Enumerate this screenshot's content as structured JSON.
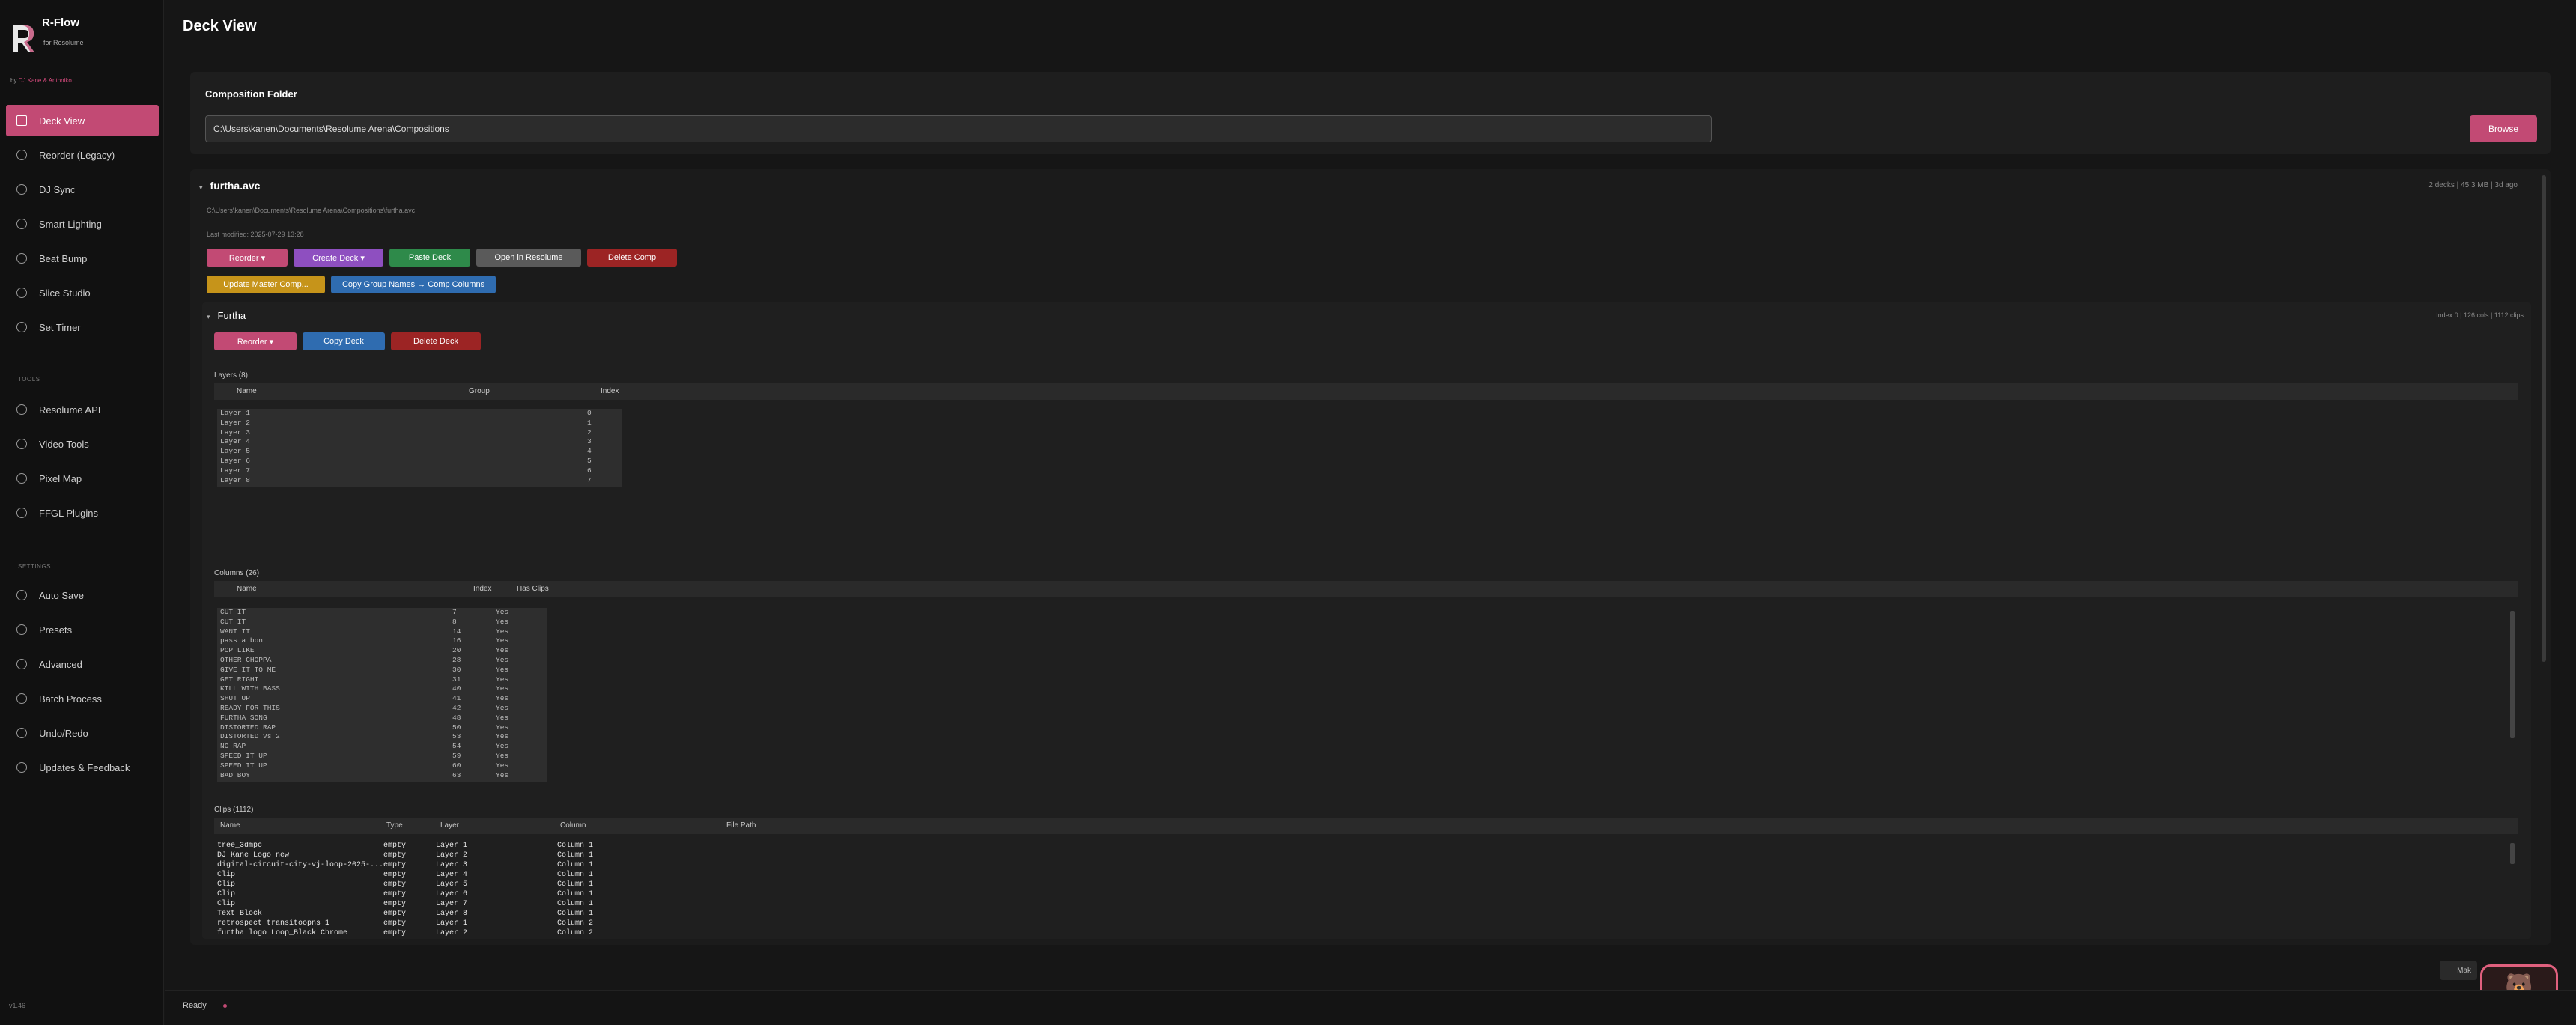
{
  "app": {
    "name": "R-Flow",
    "subtitle": "for Resolume",
    "byline_prefix": "by ",
    "byline_authors": "DJ Kane & Antoniko",
    "version": "v1.46",
    "accent": "#c24a74"
  },
  "nav": {
    "main": [
      "Deck View",
      "Reorder (Legacy)",
      "DJ Sync",
      "Smart Lighting",
      "Beat Bump",
      "Slice Studio",
      "Set Timer"
    ],
    "tools_label": "TOOLS",
    "tools": [
      "Resolume API",
      "Video Tools",
      "Pixel Map",
      "FFGL Plugins"
    ],
    "settings_label": "SETTINGS",
    "settings": [
      "Auto Save",
      "Presets",
      "Advanced",
      "Batch Process",
      "Undo/Redo",
      "Updates & Feedback"
    ]
  },
  "page": {
    "title": "Deck View"
  },
  "folder": {
    "label": "Composition Folder",
    "path": "C:\\Users\\kanen\\Documents\\Resolume Arena\\Compositions",
    "browse_label": "Browse"
  },
  "comp": {
    "name": "furtha.avc",
    "meta": "2 decks  |  45.3 MB  |  3d ago",
    "path": "C:\\Users\\kanen\\Documents\\Resolume Arena\\Compositions\\furtha.avc",
    "modified": "Last modified: 2025-07-29 13:28",
    "buttons": [
      "Reorder ▾",
      "Create Deck ▾",
      "Paste Deck",
      "Open in Resolume",
      "Delete Comp",
      "Update Master Comp...",
      "Copy Group Names → Comp Columns"
    ]
  },
  "deck": {
    "name": "Furtha",
    "meta": "Index 0  |  126 cols  |  1112 clips",
    "buttons": [
      "Reorder ▾",
      "Copy Deck",
      "Delete Deck"
    ],
    "layers": {
      "label": "Layers (8)",
      "headers": [
        "Name",
        "Group",
        "Index"
      ],
      "rows": [
        [
          "Layer 1",
          "0"
        ],
        [
          "Layer 2",
          "1"
        ],
        [
          "Layer 3",
          "2"
        ],
        [
          "Layer 4",
          "3"
        ],
        [
          "Layer 5",
          "4"
        ],
        [
          "Layer 6",
          "5"
        ],
        [
          "Layer 7",
          "6"
        ],
        [
          "Layer 8",
          "7"
        ]
      ]
    },
    "columns": {
      "label": "Columns (26)",
      "headers": [
        "Name",
        "Index",
        "Has Clips"
      ],
      "rows": [
        [
          "CUT IT",
          "7",
          "Yes"
        ],
        [
          "CUT IT",
          "8",
          "Yes"
        ],
        [
          "WANT IT",
          "14",
          "Yes"
        ],
        [
          "pass a bon",
          "16",
          "Yes"
        ],
        [
          "POP LIKE",
          "20",
          "Yes"
        ],
        [
          "OTHER CHOPPA",
          "28",
          "Yes"
        ],
        [
          "GIVE IT TO ME",
          "30",
          "Yes"
        ],
        [
          "GET RIGHT",
          "31",
          "Yes"
        ],
        [
          "KILL WITH BASS",
          "40",
          "Yes"
        ],
        [
          "SHUT UP",
          "41",
          "Yes"
        ],
        [
          "READY FOR THIS",
          "42",
          "Yes"
        ],
        [
          "FURTHA SONG",
          "48",
          "Yes"
        ],
        [
          "DISTORTED RAP",
          "50",
          "Yes"
        ],
        [
          "DISTORTED Vs 2",
          "53",
          "Yes"
        ],
        [
          "NO RAP",
          "54",
          "Yes"
        ],
        [
          "SPEED IT UP",
          "59",
          "Yes"
        ],
        [
          "SPEED IT UP",
          "60",
          "Yes"
        ],
        [
          "BAD BOY",
          "63",
          "Yes"
        ]
      ]
    },
    "clips": {
      "label": "Clips (1112)",
      "headers": [
        "Name",
        "Type",
        "Layer",
        "Column",
        "File Path"
      ],
      "rows": [
        [
          "tree_3dmpc",
          "empty",
          "Layer 1",
          "Column 1"
        ],
        [
          "DJ_Kane_Logo_new",
          "empty",
          "Layer 2",
          "Column 1"
        ],
        [
          "digital-circuit-city-vj-loop-2025-...",
          "empty",
          "Layer 3",
          "Column 1"
        ],
        [
          "Clip",
          "empty",
          "Layer 4",
          "Column 1"
        ],
        [
          "Clip",
          "empty",
          "Layer 5",
          "Column 1"
        ],
        [
          "Clip",
          "empty",
          "Layer 6",
          "Column 1"
        ],
        [
          "Clip",
          "empty",
          "Layer 7",
          "Column 1"
        ],
        [
          "Text Block",
          "empty",
          "Layer 8",
          "Column 1"
        ],
        [
          "retrospect transitoopns_1",
          "empty",
          "Layer 1",
          "Column 2"
        ],
        [
          "furtha logo Loop_Black Chrome",
          "empty",
          "Layer 2",
          "Column 2"
        ]
      ]
    }
  },
  "status": {
    "text": "Ready",
    "mini_label": "Mak"
  }
}
